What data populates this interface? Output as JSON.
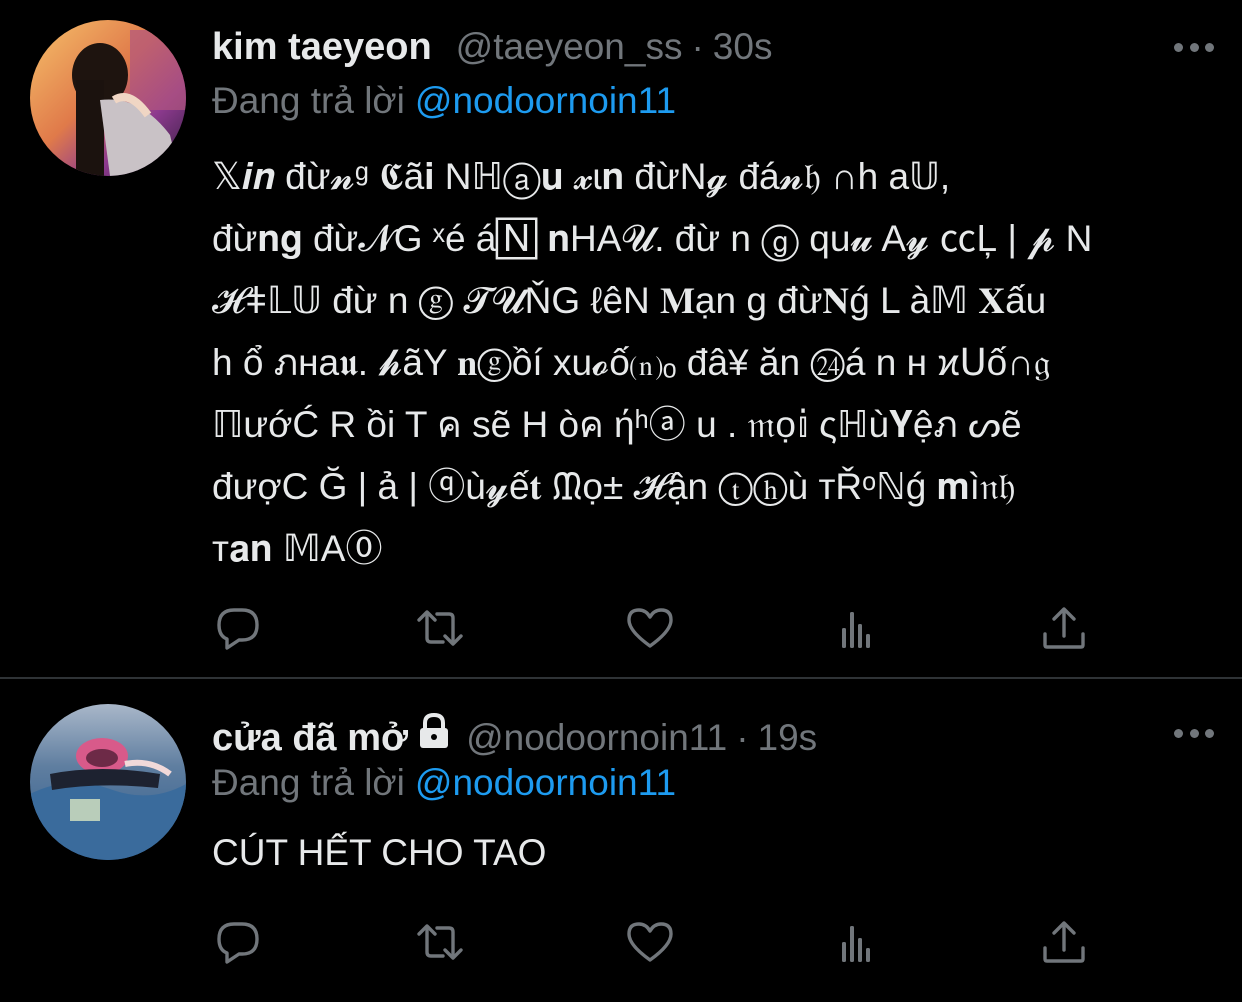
{
  "tweets": [
    {
      "name": "kim taeyeon",
      "handle": "@taeyeon_ss",
      "separator": "·",
      "time": "30s",
      "replying_label": "Đang trả lời",
      "replying_to": "@nodoornoin11",
      "lines": [
        "𝕏𝒊𝒏 đừ𝓷ᵍ 𝕮ã𝐢 Nℍⓐ𝐮 𝔁ɩ𝐧 đừN𝓰 đá𝓷𝔥 ∩h a𝕌,",
        "đừ𝐧𝐠 đừ𝓝G ˣé á🄽 𝐧HA𝓤. đừ n ⓖ qu𝓾 A𝔂 ㏄Ļ | 𝓹 N",
        "𝓗ǂ𝕃𝕌 đừ n ⓖ 𝓣𝓤ŇG ℓêN 𝐌ạn g đừ𝐍ǵ L à𝕄 𝐗ấu",
        " h ổ ภнa𝖚. 𝓱ãY 𝐧ⓖồí xu𝓸ố⒩ₒ đâ¥ ăn ㉔á n н ϰ𝖴ố∩𝔤",
        "ℿướĆ R ồi T ค sẽ H òค ήʰⓐ u . 𝔪ọ𝕚 ςℍù𝐘ệภ ᔕẽ",
        "đượC Ğ | ả | ⓠù𝔂ế𝐭 ᙢọ± 𝓗ận ⓣⓗù тŘᵒℕǵ 𝐦ì𝔫𝔥",
        "т𝐚𝐧 𝕄A⓪"
      ]
    },
    {
      "name": "cửa đã mở",
      "handle": "@nodoornoin11",
      "separator": "·",
      "time": "19s",
      "replying_label": "Đang trả lời",
      "replying_to": "@nodoornoin11",
      "lines": [
        "CÚT HẾT CHO TAO"
      ]
    }
  ],
  "icons": [
    "more-icon",
    "reply-icon",
    "retweet-icon",
    "like-icon",
    "views-icon",
    "share-icon",
    "lock-icon"
  ],
  "colors": {
    "background": "#000000",
    "text": "#e7e9ea",
    "secondary": "#71767b",
    "mention": "#1d9bf0",
    "divider": "#2f3336"
  }
}
